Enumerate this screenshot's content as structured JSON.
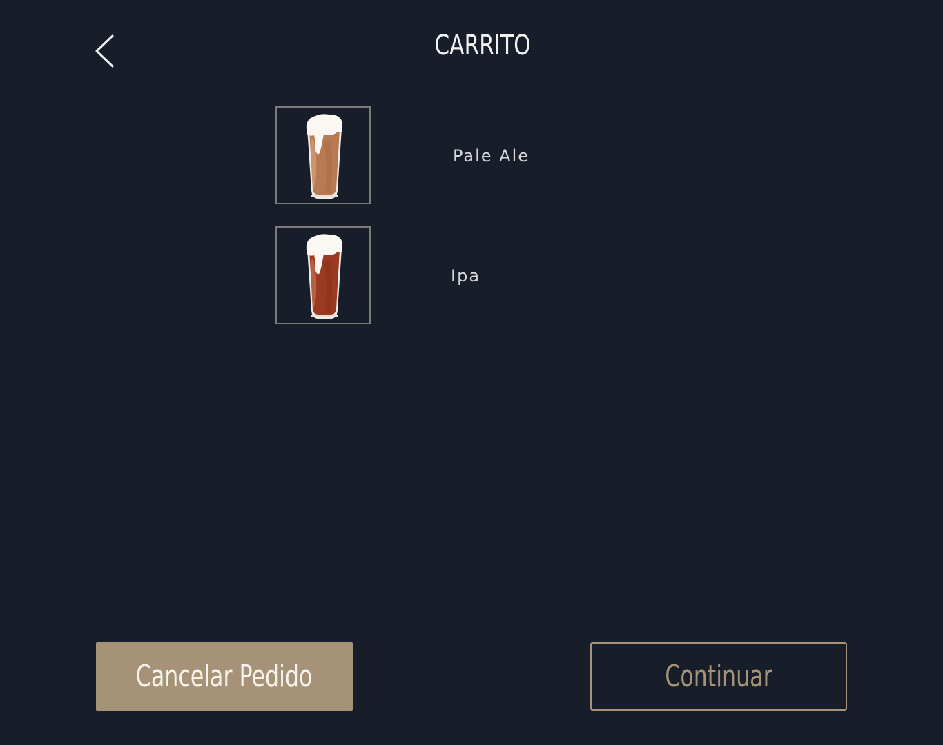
{
  "header": {
    "title": "CARRITO",
    "back_icon": "chevron-left-icon"
  },
  "cart": {
    "items": [
      {
        "name": "Pale Ale",
        "image": "beer-glass-icon",
        "beer_color": "#b87a52"
      },
      {
        "name": "Ipa",
        "image": "beer-glass-icon",
        "beer_color": "#9a3a22"
      }
    ]
  },
  "actions": {
    "cancel_label": "Cancelar Pedido",
    "continue_label": "Continuar"
  },
  "colors": {
    "background": "#181e29",
    "accent": "#a69377",
    "text": "#f2f2f2"
  }
}
